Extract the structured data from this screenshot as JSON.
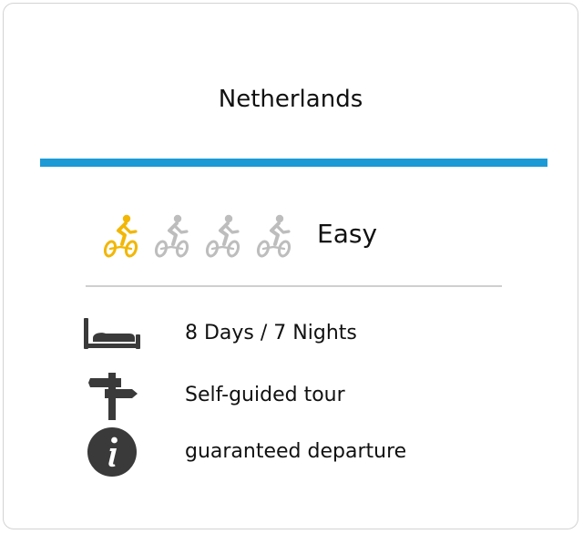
{
  "card": {
    "title": "Netherlands"
  },
  "difficulty": {
    "level": 1,
    "max_level": 4,
    "label": "Easy",
    "active_color": "#f2b705",
    "inactive_color": "#bdbdbd",
    "icon": "bicycle-rider-icon"
  },
  "info": [
    {
      "icon": "bed-icon",
      "text": "8 Days / 7 Nights"
    },
    {
      "icon": "signpost-icon",
      "text": "Self-guided tour"
    },
    {
      "icon": "info-circle-icon",
      "text": "guaranteed departure"
    }
  ],
  "colors": {
    "accent": "#1b9ad6",
    "icon_dark": "#3a3a3a",
    "divider": "#cfcfcf"
  }
}
